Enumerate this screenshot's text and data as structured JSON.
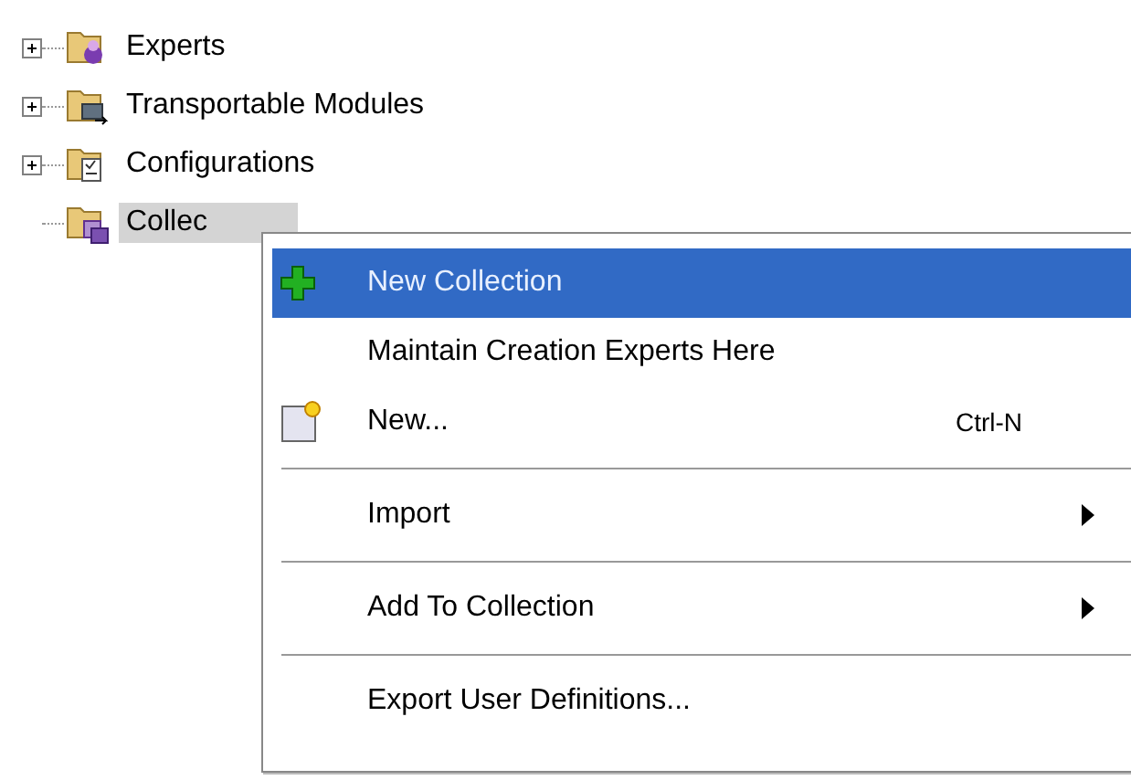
{
  "tree": {
    "items": [
      {
        "label": "Experts",
        "expandable": true,
        "selected": false
      },
      {
        "label": "Transportable Modules",
        "expandable": true,
        "selected": false
      },
      {
        "label": "Configurations",
        "expandable": true,
        "selected": false
      },
      {
        "label": "Collec",
        "expandable": false,
        "selected": true
      }
    ]
  },
  "context_menu": {
    "items": [
      {
        "kind": "item",
        "label": "New Collection",
        "selected": true
      },
      {
        "kind": "item",
        "label": "Maintain Creation Experts Here",
        "selected": false
      },
      {
        "kind": "item",
        "label": "New...",
        "shortcut": "Ctrl-N",
        "selected": false
      },
      {
        "kind": "separator"
      },
      {
        "kind": "submenu",
        "label": "Import",
        "selected": false
      },
      {
        "kind": "separator"
      },
      {
        "kind": "submenu",
        "label": "Add To Collection",
        "selected": false
      },
      {
        "kind": "separator"
      },
      {
        "kind": "item",
        "label": "Export User Definitions...",
        "selected": false
      }
    ]
  }
}
